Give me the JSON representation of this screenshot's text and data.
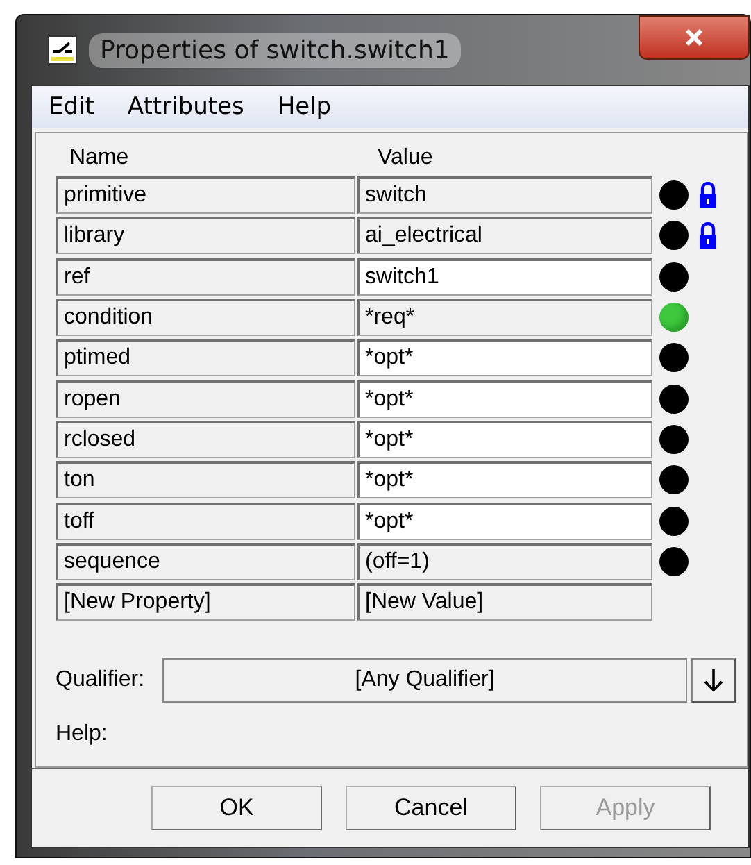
{
  "window": {
    "title": "Properties of switch.switch1"
  },
  "menu": [
    {
      "label": "Edit"
    },
    {
      "label": "Attributes"
    },
    {
      "label": "Help"
    }
  ],
  "table": {
    "columns": [
      "Name",
      "Value"
    ],
    "rows": [
      {
        "name": "primitive",
        "value": "switch",
        "editable": false,
        "color": "#000000",
        "locked": true
      },
      {
        "name": "library",
        "value": "ai_electrical",
        "editable": false,
        "color": "#000000",
        "locked": true
      },
      {
        "name": "ref",
        "value": "switch1",
        "editable": true,
        "color": "#000000",
        "locked": false
      },
      {
        "name": "condition",
        "value": "*req*",
        "editable": false,
        "color": "#3ec83e",
        "locked": false
      },
      {
        "name": "ptimed",
        "value": "*opt*",
        "editable": true,
        "color": "#000000",
        "locked": false
      },
      {
        "name": "ropen",
        "value": "*opt*",
        "editable": true,
        "color": "#000000",
        "locked": false
      },
      {
        "name": "rclosed",
        "value": "*opt*",
        "editable": true,
        "color": "#000000",
        "locked": false
      },
      {
        "name": "ton",
        "value": "*opt*",
        "editable": true,
        "color": "#000000",
        "locked": false
      },
      {
        "name": "toff",
        "value": "*opt*",
        "editable": true,
        "color": "#000000",
        "locked": false
      },
      {
        "name": "sequence",
        "value": "(off=1)",
        "editable": false,
        "color": "#000000",
        "locked": false
      },
      {
        "name": "[New Property]",
        "value": "[New Value]",
        "editable": false,
        "locked": false
      }
    ]
  },
  "qualifier": {
    "label": "Qualifier:",
    "value": "[Any Qualifier]"
  },
  "help": {
    "label": "Help:"
  },
  "buttons": [
    {
      "label": "OK",
      "disabled": false
    },
    {
      "label": "Cancel",
      "disabled": false
    },
    {
      "label": "Apply",
      "disabled": true
    }
  ]
}
